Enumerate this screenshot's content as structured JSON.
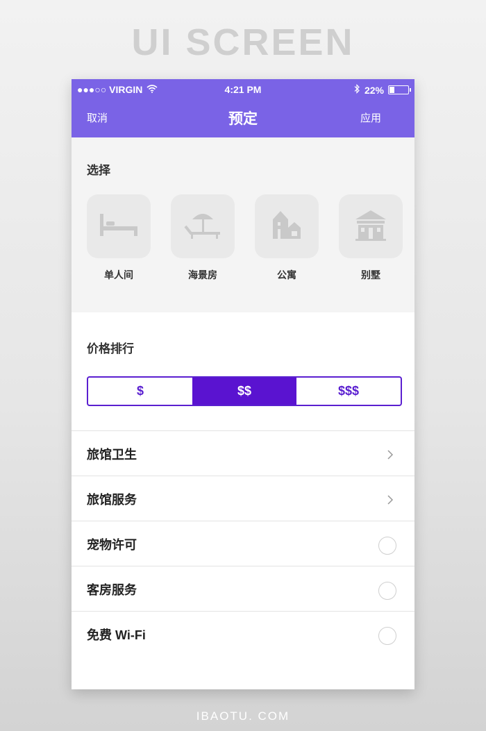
{
  "banner": "UI SCREEN",
  "footer": "IBAOTU. COM",
  "status_bar": {
    "carrier": "●●●○○ VIRGIN",
    "time": "4:21 PM",
    "battery": "22%"
  },
  "nav": {
    "left_label": "取消",
    "title": "预定",
    "right_label": "应用"
  },
  "select_section": {
    "title": "选择",
    "room_types": [
      {
        "label": "单人间",
        "icon": "bed-icon"
      },
      {
        "label": "海景房",
        "icon": "beach-umbrella-icon"
      },
      {
        "label": "公寓",
        "icon": "apartment-icon"
      },
      {
        "label": "别墅",
        "icon": "villa-icon"
      }
    ]
  },
  "price_section": {
    "title": "价格排行",
    "options": [
      "$",
      "$$",
      "$$$"
    ],
    "selected": "$$"
  },
  "filters": [
    {
      "label": "旅馆卫生",
      "control": "chevron"
    },
    {
      "label": "旅馆服务",
      "control": "chevron"
    },
    {
      "label": "宠物许可",
      "control": "radio"
    },
    {
      "label": "客房服务",
      "control": "radio"
    },
    {
      "label": "免费 Wi-Fi",
      "control": "radio"
    }
  ],
  "colors": {
    "header": "#7a63e6",
    "accent": "#5a13d0",
    "tile": "#e9e9e9",
    "icon": "#c9c9c9"
  }
}
